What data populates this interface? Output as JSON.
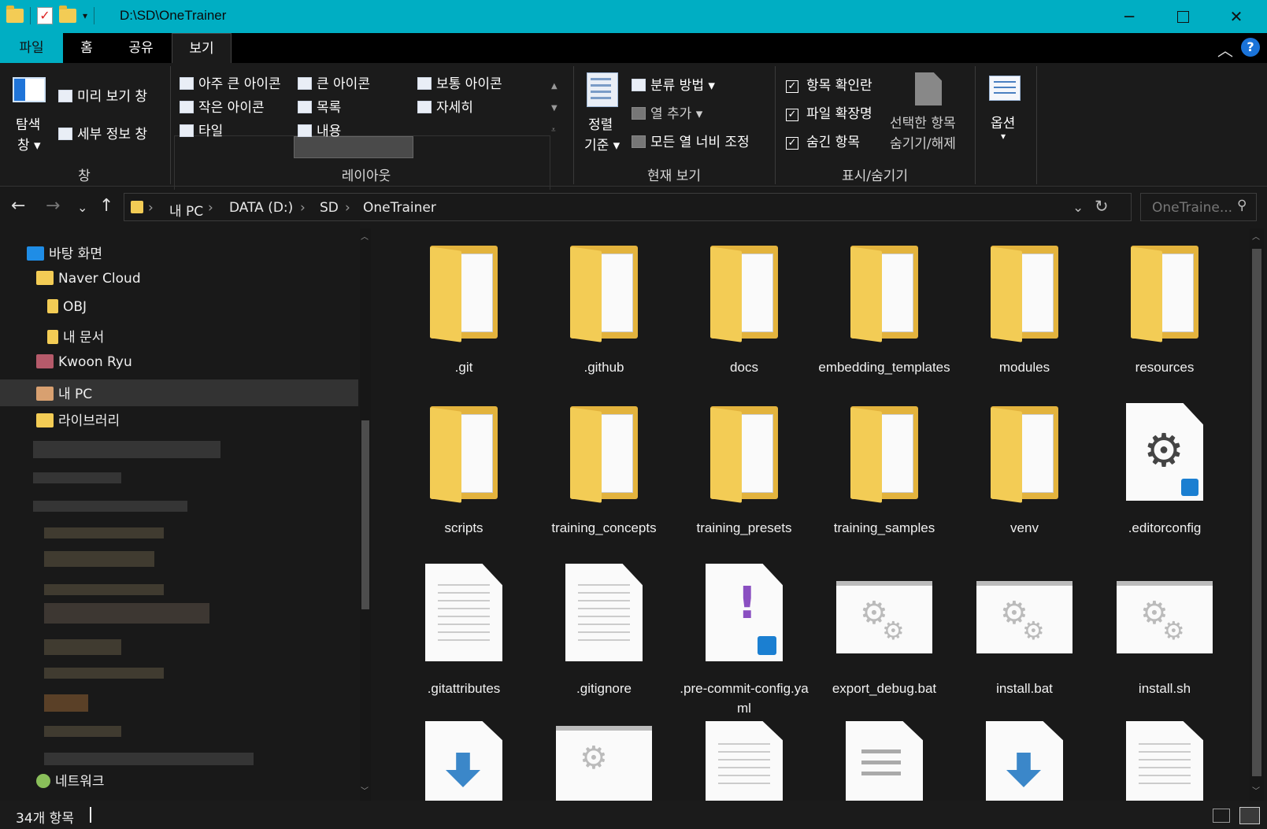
{
  "window": {
    "title": "D:\\SD\\OneTrainer",
    "minimize_icon": "minimize-icon",
    "maximize_icon": "maximize-icon",
    "close_icon": "close-icon"
  },
  "tabs": {
    "file": "파일",
    "home": "홈",
    "share": "공유",
    "view": "보기"
  },
  "ribbon": {
    "pane": {
      "nav_pane_line1": "탐색",
      "nav_pane_line2": "창",
      "preview_pane": "미리 보기 창",
      "details_pane": "세부 정보 창",
      "group_label": "창"
    },
    "layout": {
      "options": [
        "아주 큰 아이콘",
        "큰 아이콘",
        "보통 아이콘",
        "작은 아이콘",
        "목록",
        "자세히",
        "타일",
        "내용"
      ],
      "selected": "큰 아이콘",
      "group_label": "레이아웃"
    },
    "current_view": {
      "sort_line1": "정렬",
      "sort_line2": "기준",
      "group_by": "분류 방법",
      "add_columns": "열 추가",
      "size_all_columns": "모든 열 너비 조정",
      "group_label": "현재 보기"
    },
    "show_hide": {
      "item_checkboxes": "항목 확인란",
      "file_extensions": "파일 확장명",
      "hidden_items": "숨긴 항목",
      "hide_selected_line1": "선택한 항목",
      "hide_selected_line2": "숨기기/해제",
      "options": "옵션",
      "group_label": "표시/숨기기"
    }
  },
  "address": {
    "crumbs": [
      "내 PC",
      "DATA (D:)",
      "SD",
      "OneTrainer"
    ],
    "search_placeholder": "OneTraine..."
  },
  "nav_pane": {
    "items": [
      {
        "label": "바탕 화면",
        "icon": "desktop-icon"
      },
      {
        "label": "Naver Cloud",
        "icon": "cloud-folder-icon"
      },
      {
        "label": "OBJ",
        "icon": "folder-icon"
      },
      {
        "label": "내 문서",
        "icon": "folder-icon"
      },
      {
        "label": "Kwoon Ryu",
        "icon": "user-folder-icon"
      },
      {
        "label": "내 PC",
        "icon": "pc-icon"
      },
      {
        "label": "라이브러리",
        "icon": "library-icon"
      },
      {
        "label": "네트워크",
        "icon": "network-icon"
      }
    ],
    "selected": "내 PC"
  },
  "files": [
    {
      "name": ".git",
      "type": "folder"
    },
    {
      "name": ".github",
      "type": "folder"
    },
    {
      "name": "docs",
      "type": "folder"
    },
    {
      "name": "embedding_templates",
      "type": "folder"
    },
    {
      "name": "modules",
      "type": "folder"
    },
    {
      "name": "resources",
      "type": "folder"
    },
    {
      "name": "scripts",
      "type": "folder"
    },
    {
      "name": "training_concepts",
      "type": "folder"
    },
    {
      "name": "training_presets",
      "type": "folder"
    },
    {
      "name": "training_samples",
      "type": "folder"
    },
    {
      "name": "venv",
      "type": "folder"
    },
    {
      "name": ".editorconfig",
      "type": "config"
    },
    {
      "name": ".gitattributes",
      "type": "text"
    },
    {
      "name": ".gitignore",
      "type": "text"
    },
    {
      "name": ".pre-commit-config.yaml",
      "type": "yaml"
    },
    {
      "name": "export_debug.bat",
      "type": "batch"
    },
    {
      "name": "install.bat",
      "type": "batch"
    },
    {
      "name": "install.sh",
      "type": "batch"
    }
  ],
  "status": {
    "count": "34개 항목"
  }
}
